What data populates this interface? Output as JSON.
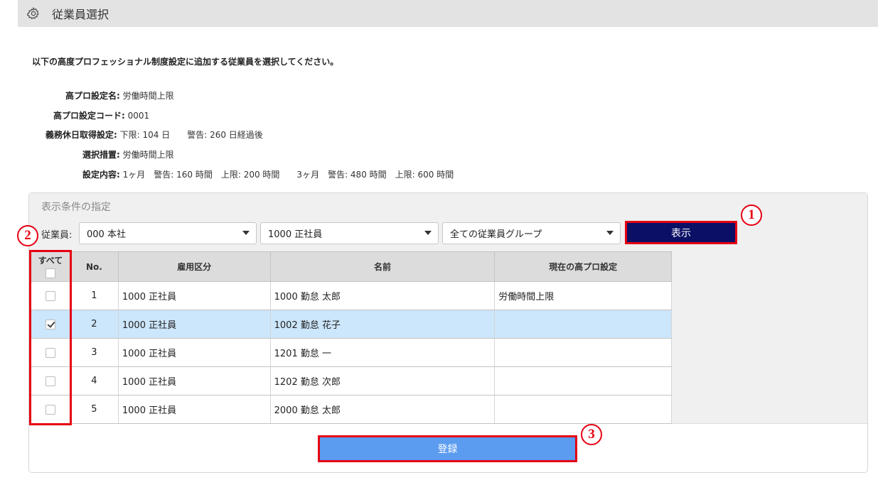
{
  "header": {
    "title": "従業員選択",
    "icon": "gear-icon"
  },
  "intro": "以下の高度プロフェッショナル制度設定に追加する従業員を選択してください。",
  "info": [
    {
      "label": "高プロ設定名:",
      "value": "労働時間上限"
    },
    {
      "label": "高プロ設定コード:",
      "value": "0001"
    },
    {
      "label": "義務休日取得設定:",
      "value": "下限: 104 日　　警告: 260 日経過後"
    },
    {
      "label": "選択措置:",
      "value": "労働時間上限"
    },
    {
      "label": "設定内容:",
      "value": "1ヶ月　警告: 160 時間　上限: 200 時間　　3ヶ月　警告: 480 時間　上限: 600 時間"
    }
  ],
  "filter": {
    "title": "表示条件の指定",
    "employee_label": "従業員:",
    "company": "000 本社",
    "employment_type": "1000 正社員",
    "group": "全ての従業員グループ",
    "show_button": "表示"
  },
  "table": {
    "headers": {
      "all": "すべて",
      "no": "No.",
      "type": "雇用区分",
      "name": "名前",
      "current": "現在の高プロ設定"
    },
    "rows": [
      {
        "no": "1",
        "type": "1000 正社員",
        "name": "1000 勤怠 太郎",
        "current": "労働時間上限",
        "checked": false
      },
      {
        "no": "2",
        "type": "1000 正社員",
        "name": "1002 勤怠 花子",
        "current": "",
        "checked": true
      },
      {
        "no": "3",
        "type": "1000 正社員",
        "name": "1201 勤怠 一",
        "current": "",
        "checked": false
      },
      {
        "no": "4",
        "type": "1000 正社員",
        "name": "1202 勤怠 次郎",
        "current": "",
        "checked": false
      },
      {
        "no": "5",
        "type": "1000 正社員",
        "name": "2000 勤怠 太郎",
        "current": "",
        "checked": false
      }
    ]
  },
  "register_button": "登録",
  "markers": {
    "m1": "1",
    "m2": "2",
    "m3": "3"
  },
  "colors": {
    "accent_red": "#e60012",
    "show_button_bg": "#0b1066",
    "register_bg": "#5b9bf0",
    "selected_row": "#cce6fb"
  }
}
